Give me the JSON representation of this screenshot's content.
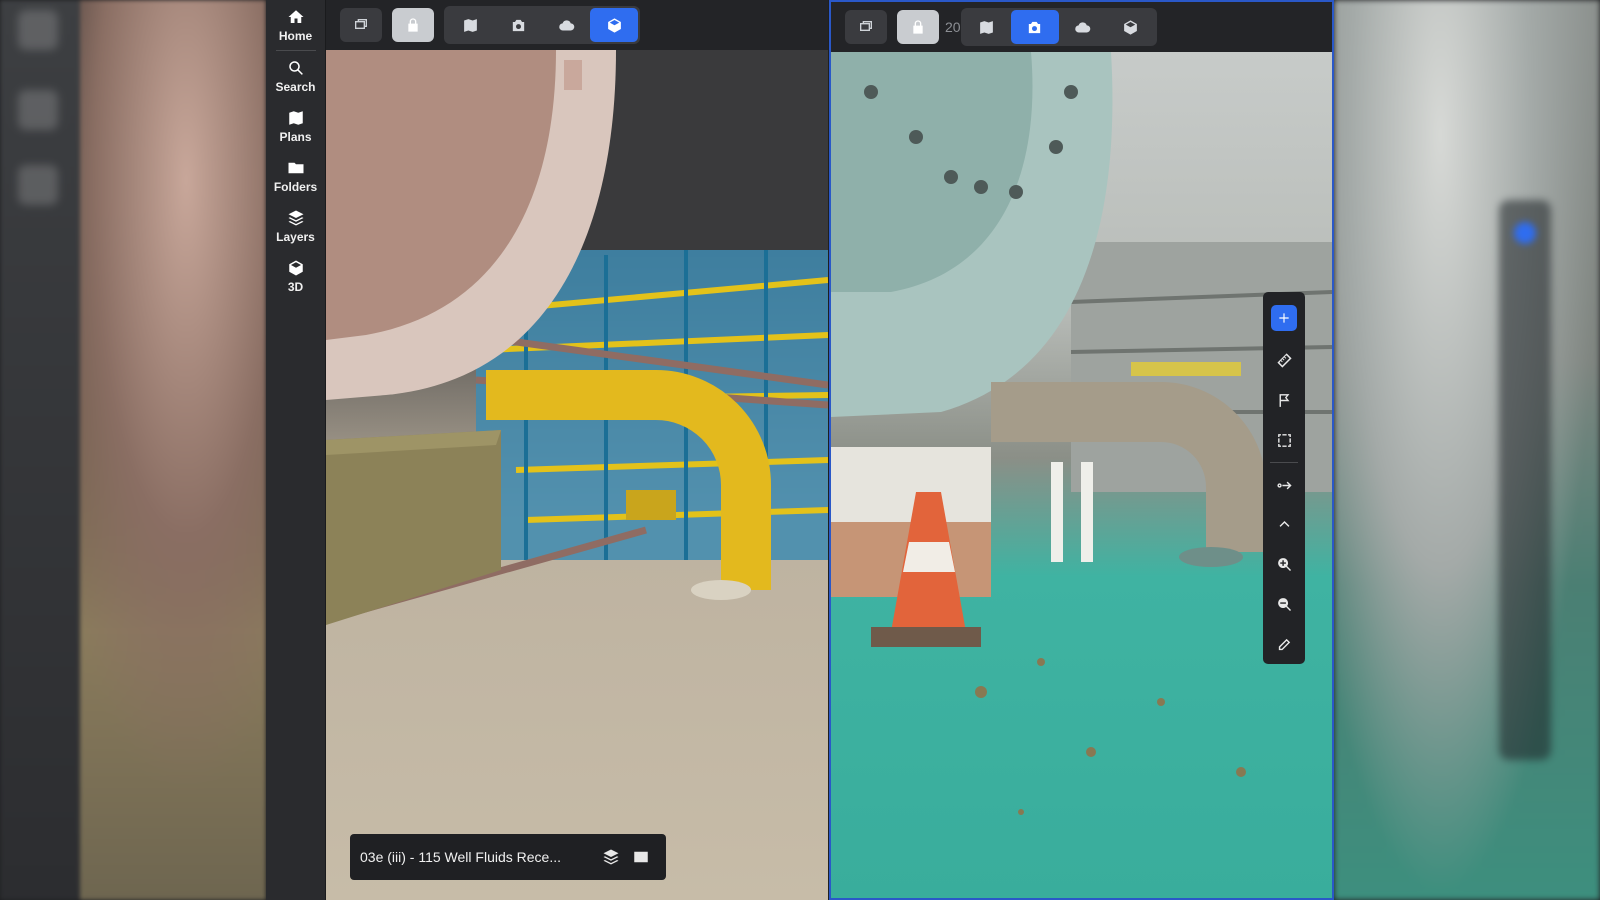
{
  "sidebar": {
    "items": [
      {
        "label": "Home",
        "icon": "home-icon"
      },
      {
        "label": "Search",
        "icon": "search-icon"
      },
      {
        "label": "Plans",
        "icon": "map-icon"
      },
      {
        "label": "Folders",
        "icon": "folder-icon"
      },
      {
        "label": "Layers",
        "icon": "layers-icon"
      },
      {
        "label": "3D",
        "icon": "cube-icon"
      }
    ]
  },
  "left_pane": {
    "toolbar": {
      "buttons": [
        "split-view-icon",
        "lock-icon"
      ],
      "view_modes": [
        "map-icon",
        "camera-icon",
        "cloud-icon",
        "cube-icon"
      ],
      "active_mode": "cube-icon"
    },
    "info_bar": {
      "title": "03e (iii) - 115 Well Fluids Rece...",
      "icons": [
        "layers-icon",
        "card-icon"
      ]
    }
  },
  "right_pane": {
    "toolbar": {
      "buttons": [
        "split-view-icon",
        "lock-icon"
      ],
      "number": "20",
      "view_modes": [
        "map-icon",
        "camera-icon",
        "cloud-icon",
        "cube-icon"
      ],
      "active_mode": "camera-icon"
    },
    "tools": [
      "plus-icon",
      "ruler-icon",
      "flag-icon",
      "select-box-icon",
      "route-icon",
      "chevron-up-icon",
      "zoom-in-icon",
      "zoom-out-icon",
      "pencil-icon"
    ]
  },
  "colors": {
    "accent": "#2f6df0",
    "sidebar_bg": "#2a2b2e",
    "toolbar_bg": "#232427",
    "active_pane_border": "#2a58c8"
  }
}
